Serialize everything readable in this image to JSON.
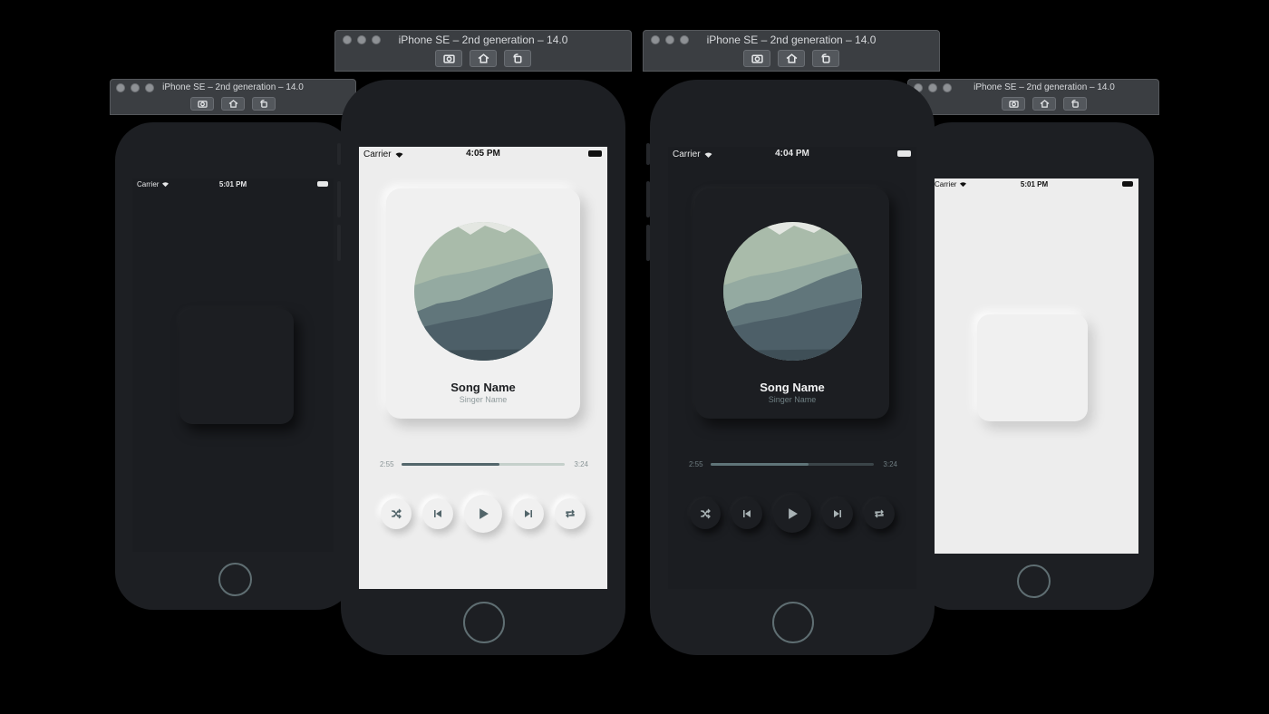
{
  "simulators": {
    "left": {
      "title": "iPhone SE – 2nd generation – 14.0",
      "carrier": "Carrier",
      "time": "5:01 PM"
    },
    "center_light": {
      "title": "iPhone SE – 2nd generation – 14.0",
      "carrier": "Carrier",
      "time": "4:05 PM",
      "song_name": "Song Name",
      "singer_name": "Singer Name",
      "elapsed": "2:55",
      "duration": "3:24",
      "progress": 0.6
    },
    "center_dark": {
      "title": "iPhone SE – 2nd generation – 14.0",
      "carrier": "Carrier",
      "time": "4:04 PM",
      "song_name": "Song Name",
      "singer_name": "Singer Name",
      "elapsed": "2:55",
      "duration": "3:24",
      "progress": 0.6
    },
    "right": {
      "title": "iPhone SE – 2nd generation – 14.0",
      "carrier": "Carrier",
      "time": "5:01 PM"
    }
  },
  "toolbar_icons": [
    "screenshot-icon",
    "home-icon",
    "rotate-icon"
  ],
  "controls": [
    "shuffle-icon",
    "previous-icon",
    "play-icon",
    "next-icon",
    "repeat-icon"
  ],
  "colors": {
    "light_bg": "#ededed",
    "dark_bg": "#1b1d21",
    "accent": "#53666b",
    "art_mint": "#a7b9a8",
    "art_slate": "#4d5f68"
  }
}
